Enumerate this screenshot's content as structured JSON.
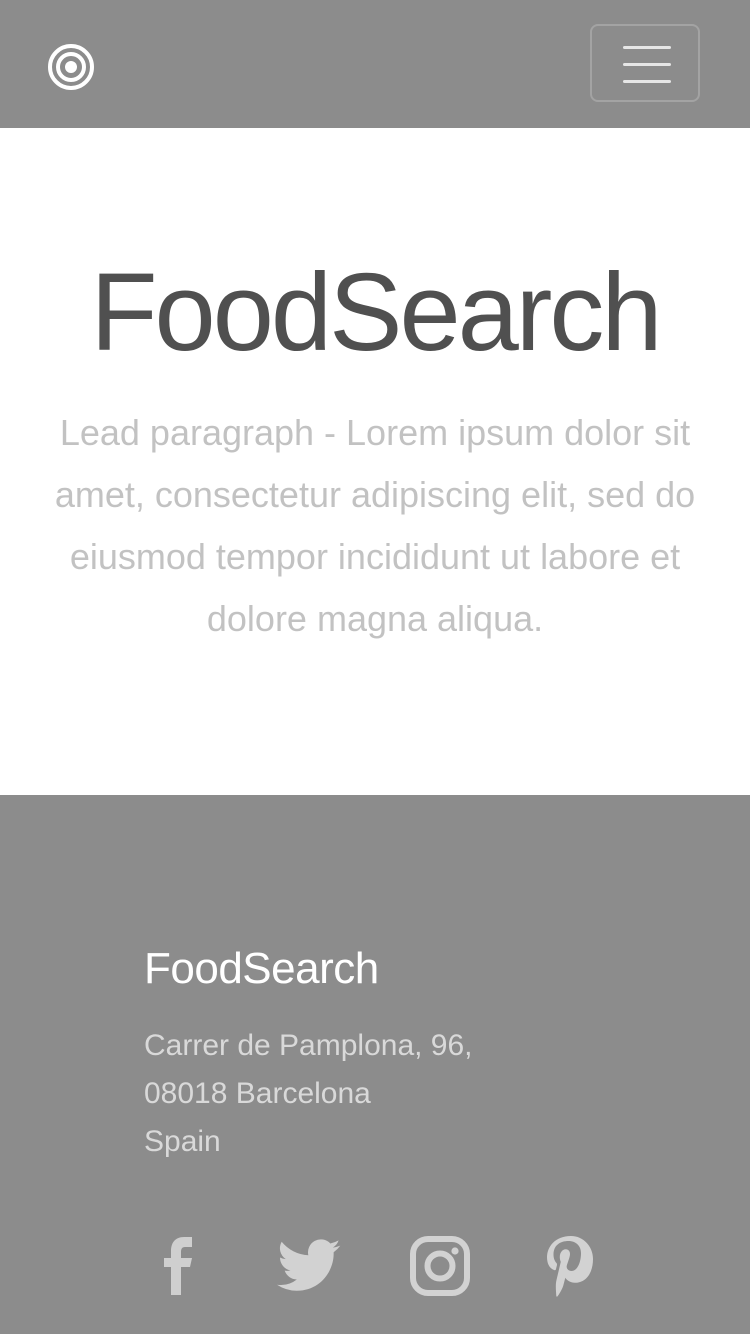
{
  "header": {
    "logo_icon": "concentric-circles-icon",
    "menu_icon": "hamburger-menu-icon",
    "background_color": "#8c8c8c"
  },
  "hero": {
    "title": "FoodSearch",
    "lead": "Lead paragraph - Lorem ipsum dolor sit amet, consectetur adipiscing elit, sed do eiusmod tempor incididunt ut labore et dolore magna aliqua."
  },
  "footer": {
    "brand": "FoodSearch",
    "address": {
      "line1": "Carrer de Pamplona, 96,",
      "line2": "08018 Barcelona",
      "line3": "Spain"
    },
    "social": [
      {
        "icon": "facebook-icon"
      },
      {
        "icon": "twitter-icon"
      },
      {
        "icon": "instagram-icon"
      },
      {
        "icon": "pinterest-icon"
      }
    ],
    "background_color": "#8c8c8c"
  }
}
